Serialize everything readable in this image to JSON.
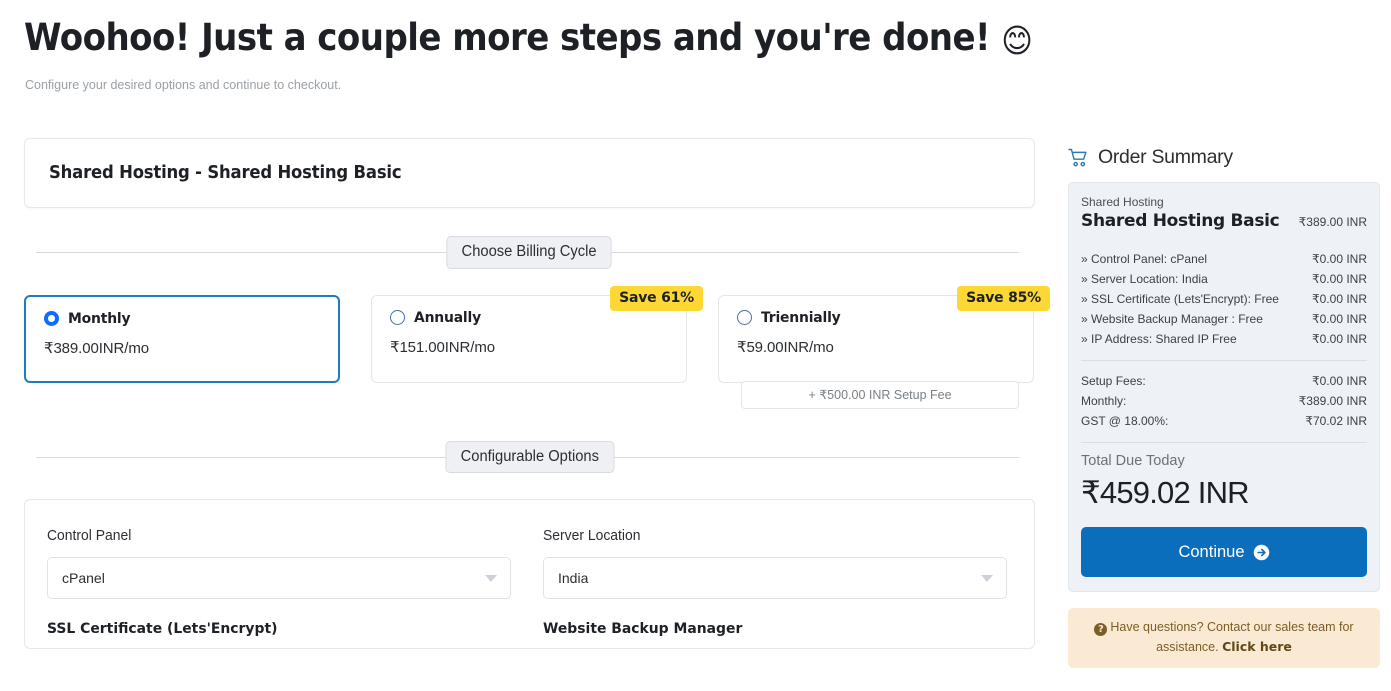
{
  "header": {
    "title": "Woohoo! Just a couple more steps and you're done!",
    "emoji": "😊",
    "subtitle": "Configure your desired options and continue to checkout."
  },
  "product": {
    "title": "Shared Hosting - Shared Hosting Basic"
  },
  "billing_section": {
    "legend": "Choose Billing Cycle",
    "options": [
      {
        "name": "Monthly",
        "price": "₹389.00INR/mo",
        "selected": true,
        "badge": null,
        "setup_fee": null
      },
      {
        "name": "Annually",
        "price": "₹151.00INR/mo",
        "selected": false,
        "badge": "Save 61%",
        "setup_fee": null
      },
      {
        "name": "Triennially",
        "price": "₹59.00INR/mo",
        "selected": false,
        "badge": "Save 85%",
        "setup_fee": "+ ₹500.00 INR Setup Fee"
      }
    ]
  },
  "configurable_section": {
    "legend": "Configurable Options",
    "fields": [
      {
        "label": "Control Panel",
        "value": "cPanel"
      },
      {
        "label": "Server Location",
        "value": "India"
      },
      {
        "label": "SSL Certificate (Lets'Encrypt)",
        "value": ""
      },
      {
        "label": "Website Backup Manager",
        "value": ""
      }
    ]
  },
  "order_summary": {
    "heading": "Order Summary",
    "cart_icon": "shopping-cart-icon",
    "category": "Shared Hosting",
    "product_name": "Shared Hosting Basic",
    "product_price": "₹389.00 INR",
    "line_items": [
      {
        "name": "» Control Panel: cPanel",
        "amount": "₹0.00 INR"
      },
      {
        "name": "» Server Location: India",
        "amount": "₹0.00 INR"
      },
      {
        "name": "» SSL Certificate (Lets'Encrypt): Free",
        "amount": "₹0.00 INR"
      },
      {
        "name": "» Website Backup Manager : Free",
        "amount": "₹0.00 INR"
      },
      {
        "name": "» IP Address: Shared IP Free",
        "amount": "₹0.00 INR"
      }
    ],
    "totals": [
      {
        "name": "Setup Fees:",
        "amount": "₹0.00 INR"
      },
      {
        "name": "Monthly:",
        "amount": "₹389.00 INR"
      },
      {
        "name": "GST @ 18.00%:",
        "amount": "₹70.02 INR"
      }
    ],
    "due_label": "Total Due Today",
    "due_amount": "₹459.02 INR",
    "continue_label": "Continue"
  },
  "help": {
    "text": "Have questions? Contact our sales team for assistance. ",
    "link": "Click here"
  },
  "colors": {
    "accent_blue": "#0a6ebd",
    "selected_border": "#1f7cc0",
    "badge_yellow": "#fdd835",
    "summary_bg": "#eef1f5",
    "help_bg": "#fbead3"
  }
}
